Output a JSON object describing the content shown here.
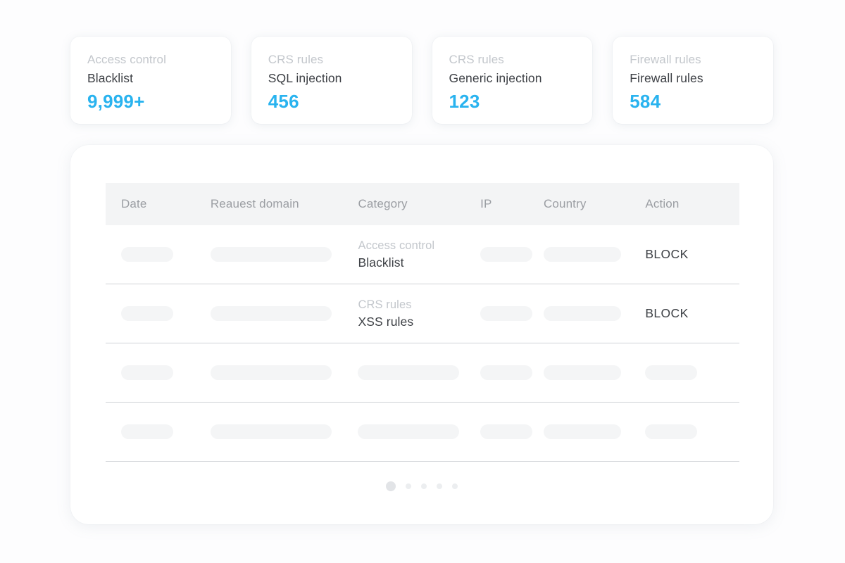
{
  "stat_cards": [
    {
      "subtitle": "Access control",
      "title": "Blacklist",
      "value": "9,999+"
    },
    {
      "subtitle": "CRS rules",
      "title": "SQL injection",
      "value": "456"
    },
    {
      "subtitle": "CRS rules",
      "title": "Generic injection",
      "value": "123"
    },
    {
      "subtitle": "Firewall rules",
      "title": "Firewall rules",
      "value": "584"
    }
  ],
  "table": {
    "columns": [
      "Date",
      "Reauest domain",
      "Category",
      "IP",
      "Country",
      "Action"
    ],
    "rows": [
      {
        "date": "",
        "domain": "",
        "category_sub": "Access control",
        "category_main": "Blacklist",
        "ip": "",
        "country": "",
        "action": "BLOCK"
      },
      {
        "date": "",
        "domain": "",
        "category_sub": "CRS rules",
        "category_main": "XSS rules",
        "ip": "",
        "country": "",
        "action": "BLOCK"
      },
      {
        "date": "",
        "domain": "",
        "category_sub": "",
        "category_main": "",
        "ip": "",
        "country": "",
        "action": ""
      },
      {
        "date": "",
        "domain": "",
        "category_sub": "",
        "category_main": "",
        "ip": "",
        "country": "",
        "action": ""
      }
    ]
  },
  "pagination": {
    "total_pages": 5,
    "active_page": 1
  },
  "colors": {
    "accent": "#29b3ef",
    "text_primary": "#3d4045",
    "text_muted": "#c3c7cc",
    "header_bg": "#f3f4f5",
    "skeleton": "#f4f5f6",
    "divider": "#cfd2d6",
    "page_bg": "#fdfdfe"
  }
}
